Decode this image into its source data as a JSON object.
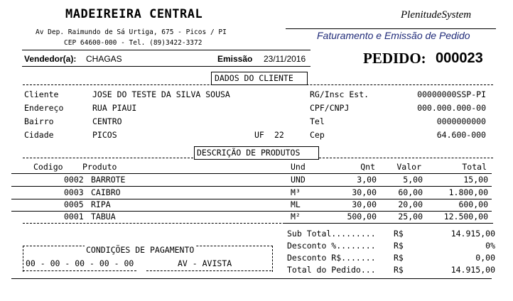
{
  "company": {
    "name": "MADEIREIRA CENTRAL",
    "address": "Av Dep. Raimundo de Sá Urtiga, 675 - Picos / PI",
    "cep_tel": "CEP 64600-000 - Tel.  (89)3422-3372"
  },
  "brand": {
    "system_name": "PlenitudeSystem",
    "document_type": "Faturamento e Emissão de Pedido"
  },
  "header": {
    "seller_label": "Vendedor(a):",
    "seller_value": "CHAGAS",
    "issue_label": "Emissão",
    "issue_date": "23/11/2016",
    "order_label": "PEDIDO:",
    "order_number": "000023"
  },
  "client_section": {
    "title": "DADOS DO CLIENTE",
    "cliente_label": "Cliente",
    "cliente_value": "JOSE DO TESTE DA SILVA SOUSA",
    "endereco_label": "Endereço",
    "endereco_value": "RUA PIAUI",
    "bairro_label": "Bairro",
    "bairro_value": "CENTRO",
    "cidade_label": "Cidade",
    "cidade_value": "PICOS",
    "uf_label": "UF",
    "uf_value": "22",
    "rg_label": "RG/Insc Est.",
    "rg_value": "00000000SSP-PI",
    "cpf_label": "CPF/CNPJ",
    "cpf_value": "000.000.000-00",
    "tel_label": "Tel",
    "tel_value": "0000000000",
    "cep_label": "Cep",
    "cep_value": "64.600-000"
  },
  "products_section": {
    "title": "DESCRIÇÃO DE PRODUTOS",
    "columns": {
      "codigo": "Codigo",
      "produto": "Produto",
      "und": "Und",
      "qnt": "Qnt",
      "valor": "Valor",
      "total": "Total"
    },
    "items": [
      {
        "codigo": "0002",
        "produto": "BARROTE",
        "und": "UND",
        "qnt": "3,00",
        "valor": "5,00",
        "total": "15,00"
      },
      {
        "codigo": "0003",
        "produto": "CAIBRO",
        "und": "M³",
        "qnt": "30,00",
        "valor": "60,00",
        "total": "1.800,00"
      },
      {
        "codigo": "0005",
        "produto": "RIPA",
        "und": "ML",
        "qnt": "30,00",
        "valor": "20,00",
        "total": "600,00"
      },
      {
        "codigo": "0001",
        "produto": "TABUA",
        "und": "M²",
        "qnt": "500,00",
        "valor": "25,00",
        "total": "12.500,00"
      }
    ]
  },
  "payment": {
    "title": "CONDIÇÕES DE PAGAMENTO",
    "dates": "00 - 00 - 00 - 00 - 00",
    "method": "AV - AVISTA"
  },
  "totals": {
    "subtotal_label": "Sub Total.........",
    "subtotal_currency": "R$",
    "subtotal_value": "14.915,00",
    "desc_pct_label": "Desconto %........",
    "desc_pct_currency": "R$",
    "desc_pct_value": "0%",
    "desc_rs_label": "Desconto R$.......",
    "desc_rs_currency": "R$",
    "desc_rs_value": "0,00",
    "total_label": "Total do Pedido...",
    "total_currency": "R$",
    "total_value": "14.915,00"
  }
}
